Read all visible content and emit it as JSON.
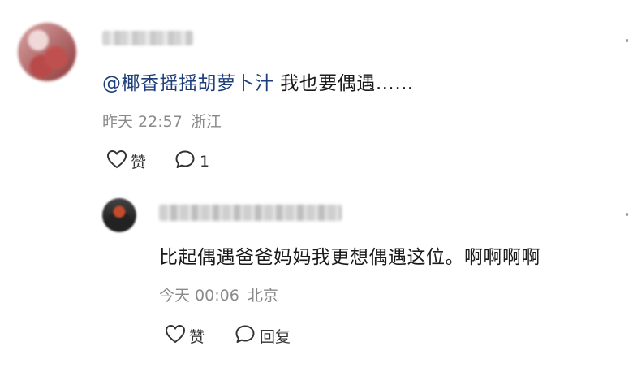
{
  "comment": {
    "mention": "@椰香摇摇胡萝卜汁",
    "text": " 我也要偶遇……",
    "time": "昨天 22:57",
    "location": "浙江",
    "like_label": "赞",
    "reply_count": "1"
  },
  "reply": {
    "text": "比起偶遇爸爸妈妈我更想偶遇这位。啊啊啊啊",
    "time": "今天 00:06",
    "location": "北京",
    "like_label": "赞",
    "reply_label": "回复"
  },
  "icons": {
    "like": "heart-icon",
    "comment": "speech-bubble-icon"
  }
}
